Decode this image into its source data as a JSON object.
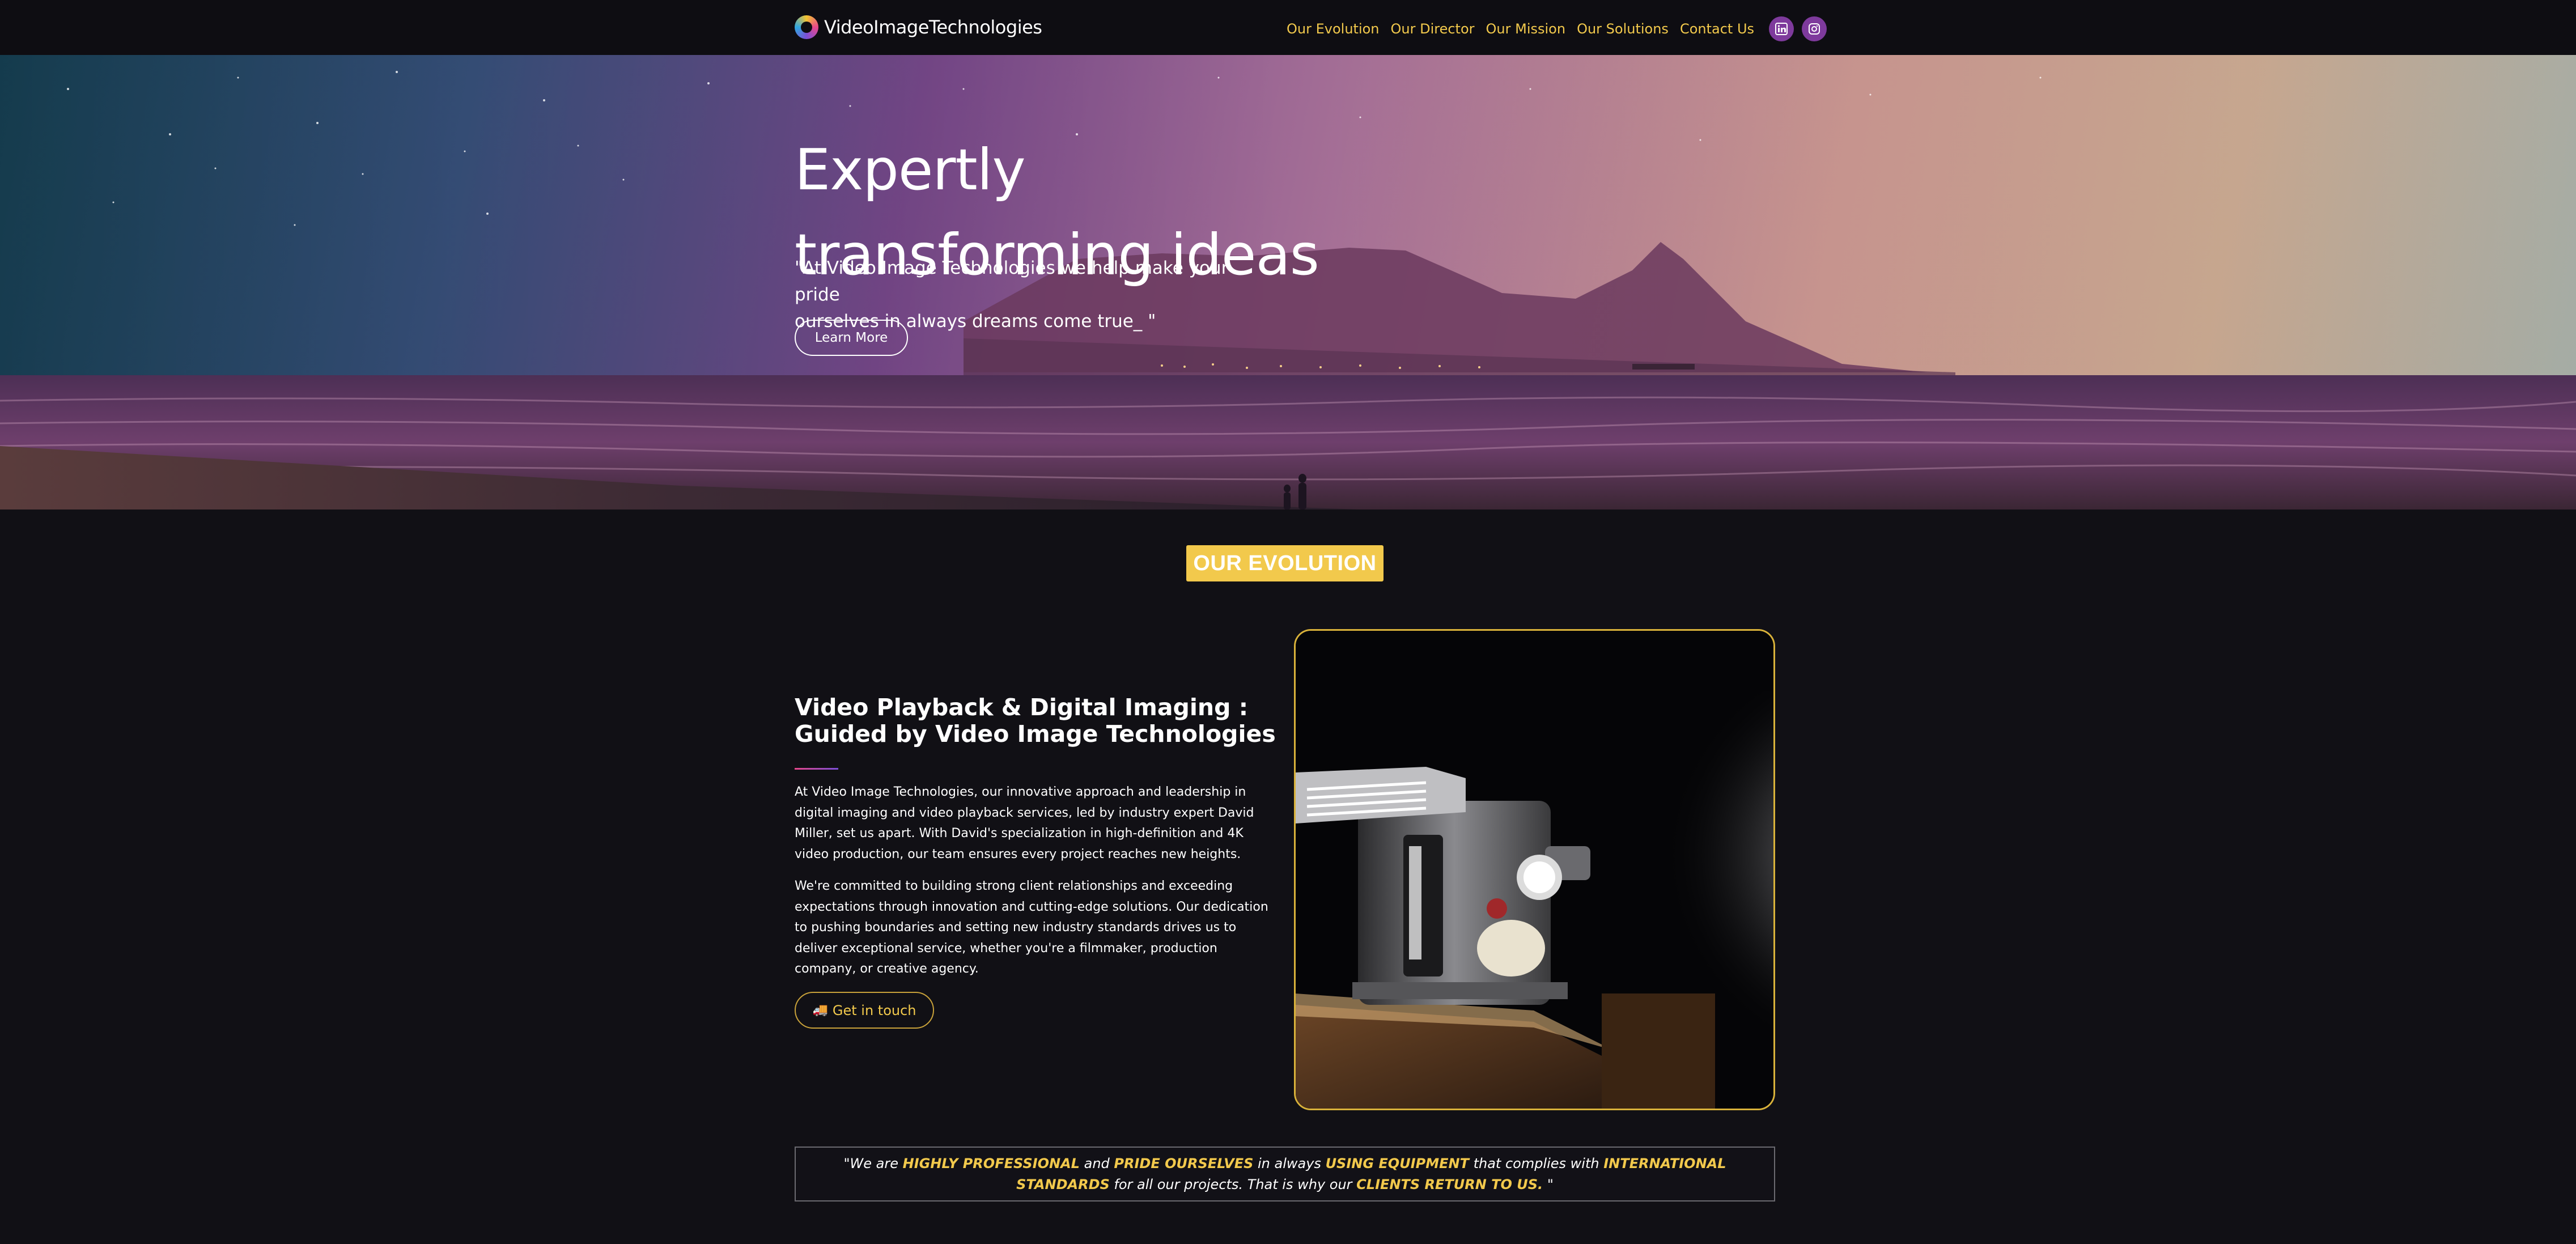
{
  "colors": {
    "accent": "#f2c94c",
    "background": "#111015",
    "social": "#7e3a9c"
  },
  "nav": {
    "brand": "VideoImageTechnologies",
    "links": [
      "Our Evolution",
      "Our Director",
      "Our Mission",
      "Our Solutions",
      "Contact Us"
    ],
    "social_icons": [
      "linkedin-icon",
      "instagram-icon"
    ]
  },
  "hero": {
    "title_line1": "Expertly",
    "title_line2": "transforming ideas",
    "quote_line1": "\"At Video Image Technologies we help make your pride",
    "quote_line2": "ourselves in always dreams come true_ \"",
    "button": "Learn More"
  },
  "evolution": {
    "badge": "OUR EVOLUTION",
    "heading": "Video Playback & Digital Imaging : Guided by Video Image Technologies",
    "para1": "At Video Image Technologies, our innovative approach and leadership in digital imaging and video playback services, led by industry expert David Miller, set us apart. With David's specialization in high-definition and 4K video production, our team ensures every project reaches new heights.",
    "para2": "We're committed to building strong client relationships and exceeding expectations through innovation and cutting-edge solutions. Our dedication to pushing boundaries and setting new industry standards drives us to deliver exceptional service, whether you're a filmmaker, production company, or creative agency.",
    "button": "Get in touch",
    "button_icon": "truck-icon"
  },
  "quote": {
    "p1": "\"We are ",
    "h1": "HIGHLY PROFESSIONAL",
    "p2": " and ",
    "h2": "PRIDE OURSELVES",
    "p3": " in always ",
    "h3": "USING EQUIPMENT",
    "p4": " that complies with ",
    "h4": "INTERNATIONAL STANDARDS",
    "p5": " for all our projects. That is why our ",
    "h5": "CLIENTS RETURN TO US.",
    "p6": " \""
  }
}
